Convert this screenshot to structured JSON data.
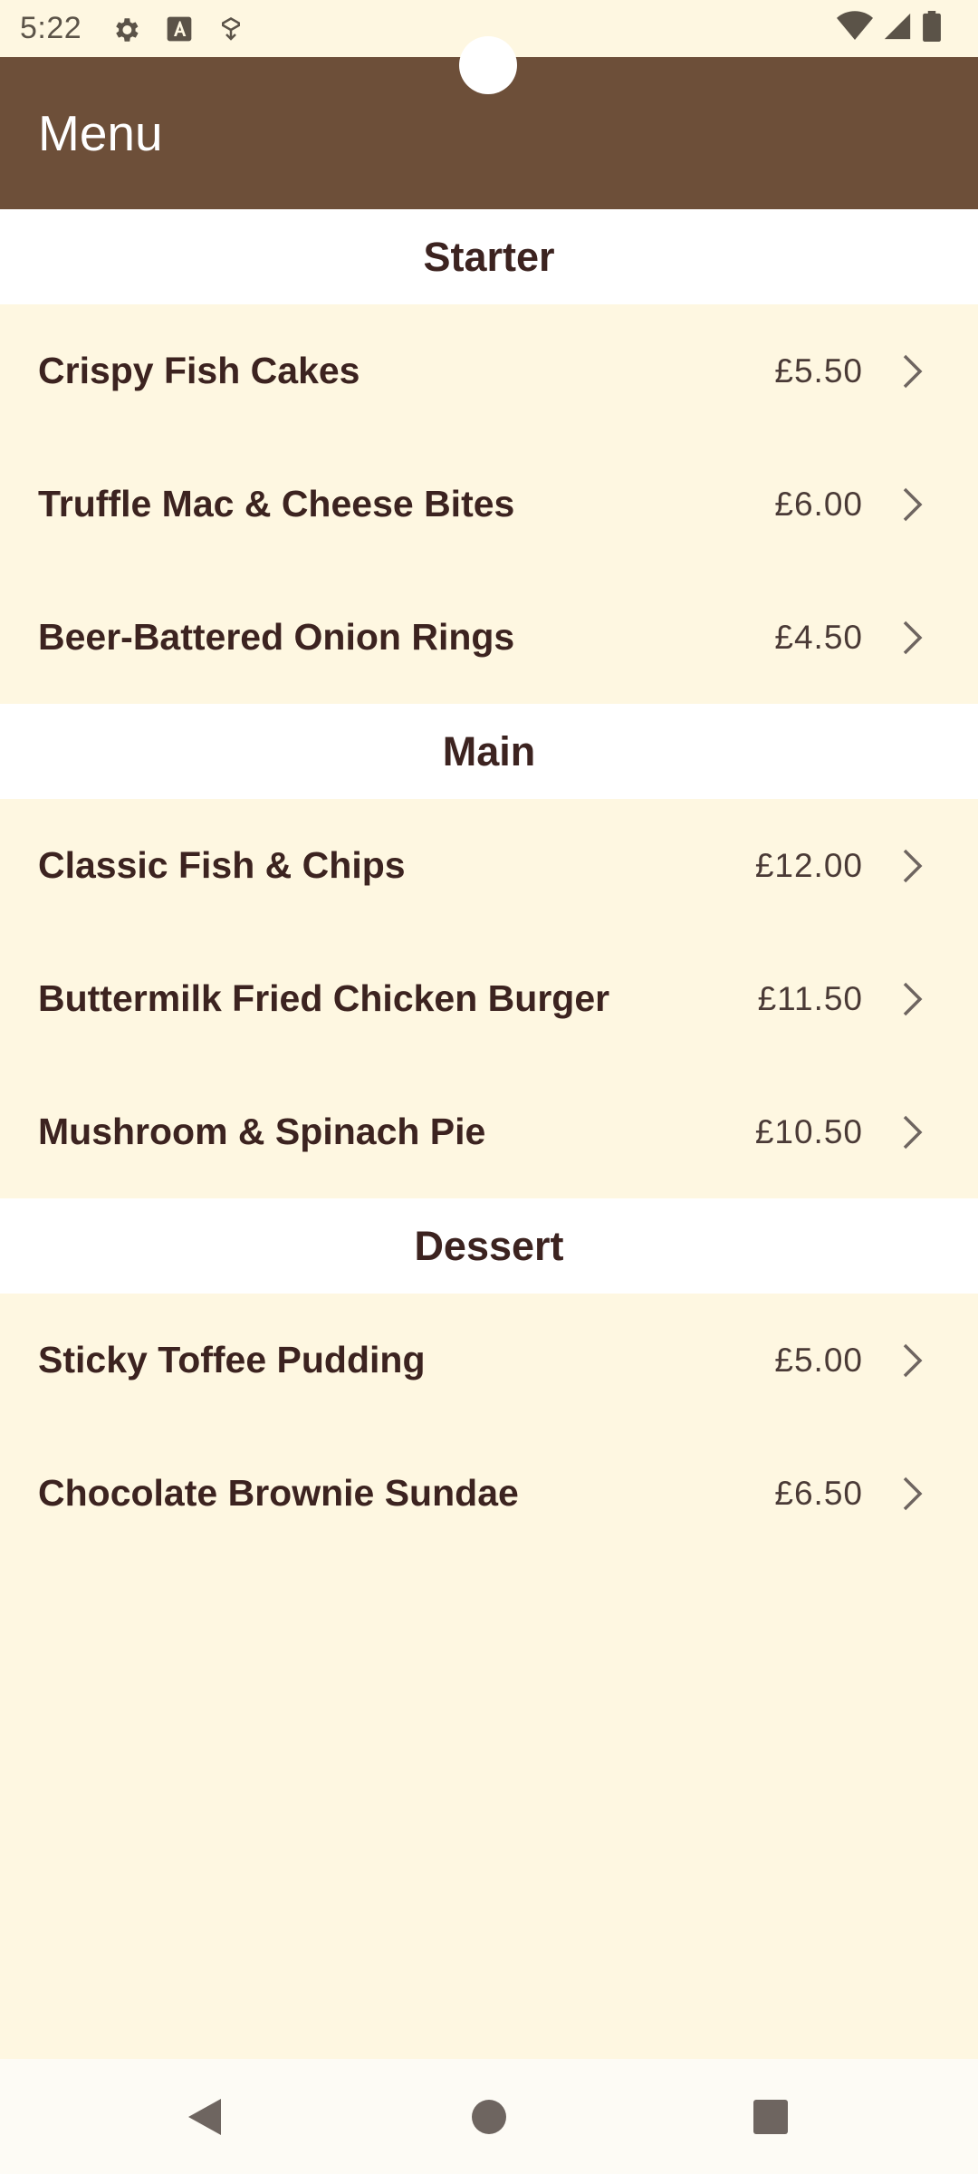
{
  "status_bar": {
    "time": "5:22",
    "icons_left": [
      "gear-icon",
      "text-a-icon",
      "shield-download-icon"
    ],
    "icons_right": [
      "wifi-icon",
      "signal-icon",
      "battery-icon"
    ]
  },
  "app_bar": {
    "title": "Menu",
    "background": "#6D4F39"
  },
  "sections": [
    {
      "title": "Starter",
      "items": [
        {
          "name": "Crispy Fish Cakes",
          "price": "£5.50"
        },
        {
          "name": "Truffle Mac & Cheese Bites",
          "price": "£6.00"
        },
        {
          "name": "Beer-Battered Onion Rings",
          "price": "£4.50"
        }
      ]
    },
    {
      "title": "Main",
      "items": [
        {
          "name": "Classic Fish & Chips",
          "price": "£12.00"
        },
        {
          "name": "Buttermilk Fried Chicken Burger",
          "price": "£11.50"
        },
        {
          "name": "Mushroom & Spinach Pie",
          "price": "£10.50"
        }
      ]
    },
    {
      "title": "Dessert",
      "items": [
        {
          "name": "Sticky Toffee Pudding",
          "price": "£5.00"
        },
        {
          "name": "Chocolate Brownie Sundae",
          "price": "£6.50"
        }
      ]
    }
  ],
  "nav_bar": {
    "buttons": [
      "back-icon",
      "home-icon",
      "recents-icon"
    ]
  },
  "colors": {
    "app_bar": "#6D4F39",
    "list_background": "#FEF7E1",
    "section_header_background": "#FFFFFF",
    "text": "#3C2320"
  }
}
